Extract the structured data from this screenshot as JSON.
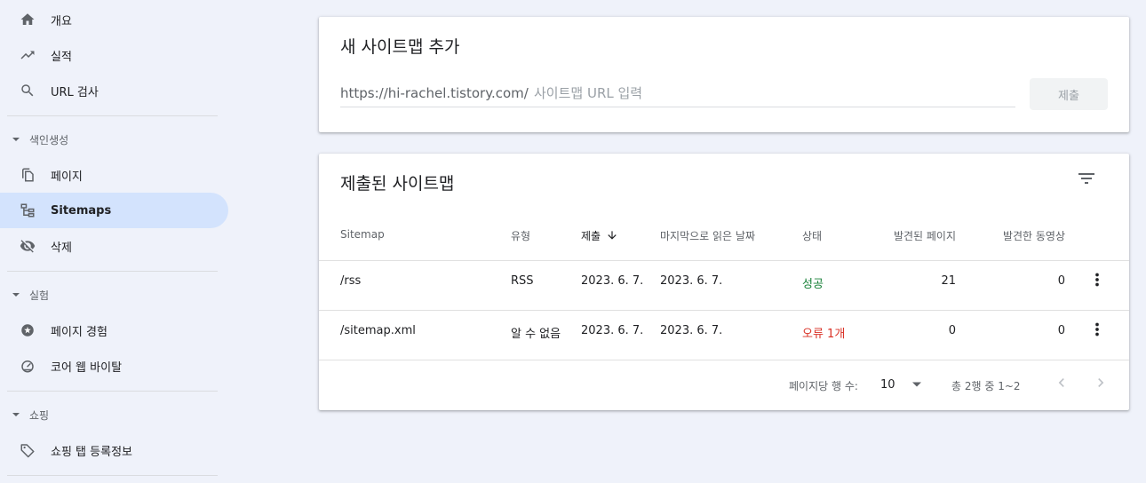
{
  "sidebar": {
    "items": [
      {
        "label": "개요",
        "icon": "home-icon"
      },
      {
        "label": "실적",
        "icon": "trending-up-icon"
      },
      {
        "label": "URL 검사",
        "icon": "search-icon"
      }
    ],
    "sections": [
      {
        "title": "색인생성",
        "items": [
          {
            "label": "페이지",
            "icon": "pages-icon"
          },
          {
            "label": "Sitemaps",
            "icon": "sitemap-icon",
            "active": true
          },
          {
            "label": "삭제",
            "icon": "visibility-off-icon"
          }
        ]
      },
      {
        "title": "실험",
        "items": [
          {
            "label": "페이지 경험",
            "icon": "page-experience-icon"
          },
          {
            "label": "코어 웹 바이탈",
            "icon": "speed-gauge-icon"
          }
        ]
      },
      {
        "title": "쇼핑",
        "items": [
          {
            "label": "쇼핑 탭 등록정보",
            "icon": "tag-icon"
          }
        ]
      }
    ]
  },
  "add_sitemap": {
    "title": "새 사이트맵 추가",
    "prefix": "https://hi-rachel.tistory.com/",
    "placeholder": "사이트맵 URL 입력",
    "submit_label": "제출"
  },
  "submitted": {
    "title": "제출된 사이트맵",
    "columns": [
      "Sitemap",
      "유형",
      "제출",
      "마지막으로 읽은 날짜",
      "상태",
      "발견된 페이지",
      "발견한 동영상"
    ],
    "rows": [
      {
        "sitemap": "/rss",
        "type": "RSS",
        "submitted": "2023. 6. 7.",
        "last_read": "2023. 6. 7.",
        "status": "성공",
        "status_kind": "success",
        "pages": "21",
        "videos": "0"
      },
      {
        "sitemap": "/sitemap.xml",
        "type": "알 수 없음",
        "submitted": "2023. 6. 7.",
        "last_read": "2023. 6. 7.",
        "status": "오류 1개",
        "status_kind": "error",
        "pages": "0",
        "videos": "0"
      }
    ],
    "footer": {
      "rows_per_page_label": "페이지당 행 수:",
      "rows_per_page": "10",
      "range_text": "총 2행 중 1~2"
    }
  },
  "colors": {
    "background": "#eff2fa",
    "active_nav": "#d3e3fd",
    "success": "#188038",
    "error": "#d93025",
    "muted_text": "#5f6368"
  }
}
